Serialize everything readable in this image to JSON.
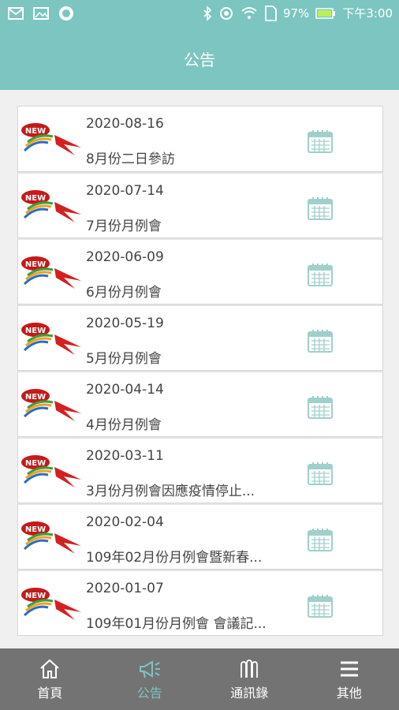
{
  "status_bar": {
    "battery": "97%",
    "time": "下午3:00"
  },
  "header": {
    "title": "公告"
  },
  "announcements": [
    {
      "date": "2020-08-16",
      "title": "8月份二日參訪"
    },
    {
      "date": "2020-07-14",
      "title": "7月份月例會"
    },
    {
      "date": "2020-06-09",
      "title": "6月份月例會"
    },
    {
      "date": "2020-05-19",
      "title": "5月份月例會"
    },
    {
      "date": "2020-04-14",
      "title": "4月份月例會"
    },
    {
      "date": "2020-03-11",
      "title": "3月份月例會因應疫情停止..."
    },
    {
      "date": "2020-02-04",
      "title": "109年02月份月例會暨新春..."
    },
    {
      "date": "2020-01-07",
      "title": "109年01月份月例會 會議記..."
    }
  ],
  "badge_text": "NEW",
  "tabs": [
    {
      "label": "首頁",
      "icon": "home-icon",
      "active": false
    },
    {
      "label": "公告",
      "icon": "megaphone-icon",
      "active": true
    },
    {
      "label": "通訊錄",
      "icon": "contacts-icon",
      "active": false
    },
    {
      "label": "其他",
      "icon": "menu-icon",
      "active": false
    }
  ],
  "colors": {
    "accent": "#7cc5c0",
    "tabbar": "#737373"
  }
}
